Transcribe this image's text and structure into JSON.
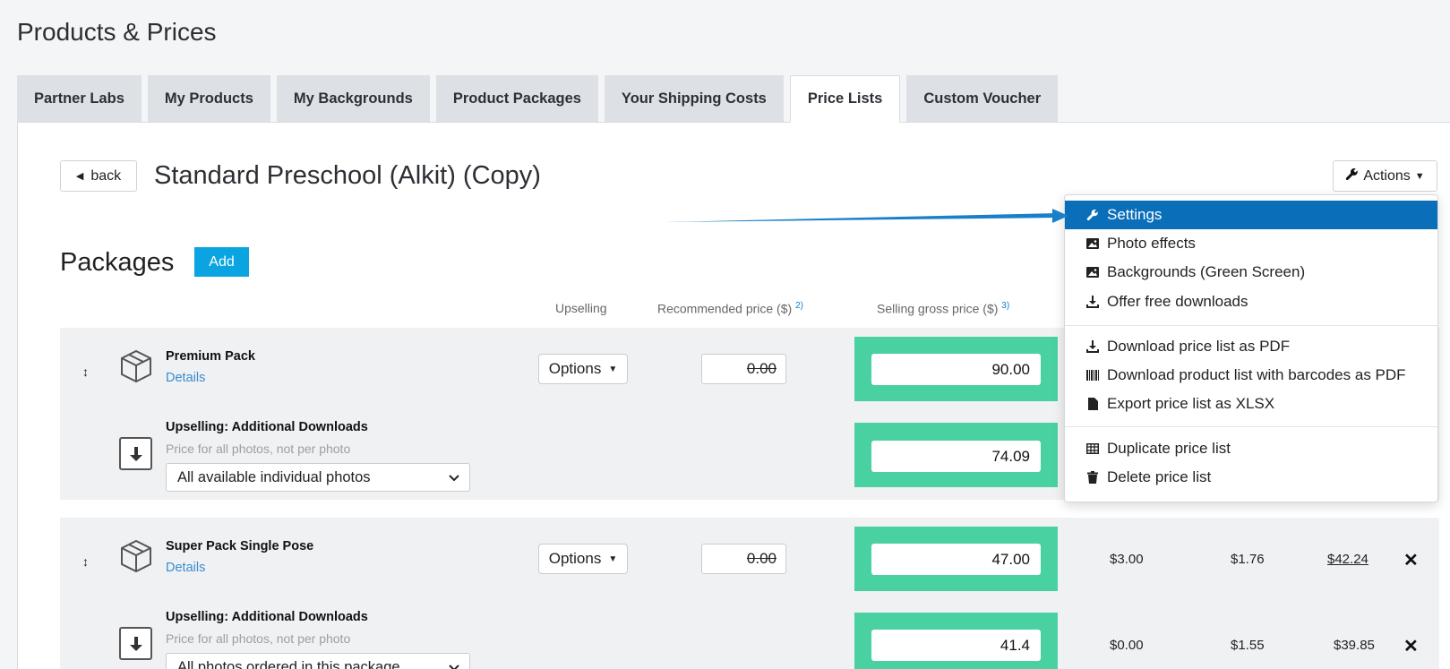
{
  "page": {
    "title": "Products & Prices"
  },
  "tabs": [
    {
      "label": "Partner Labs"
    },
    {
      "label": "My Products"
    },
    {
      "label": "My Backgrounds"
    },
    {
      "label": "Product Packages"
    },
    {
      "label": "Your Shipping Costs"
    },
    {
      "label": "Price Lists",
      "active": true
    },
    {
      "label": "Custom Voucher"
    }
  ],
  "header": {
    "back_label": "back",
    "list_title": "Standard Preschool (Alkit) (Copy)",
    "actions_label": "Actions"
  },
  "packages": {
    "title": "Packages",
    "add_label": "Add",
    "columns": {
      "upselling": "Upselling",
      "recommended": "Recommended price ($)",
      "recommended_note": "2)",
      "selling": "Selling gross price ($)",
      "selling_note": "3)"
    },
    "items": [
      {
        "name": "Premium Pack",
        "details_label": "Details",
        "options_label": "Options",
        "recommended_price": "0.00",
        "selling_price": "90.00",
        "upsell": {
          "title": "Upselling: Additional Downloads",
          "subtitle": "Price for all photos, not per photo",
          "select_value": "All available individual photos",
          "selling_price": "74.09"
        }
      },
      {
        "name": "Super Pack Single Pose",
        "details_label": "Details",
        "options_label": "Options",
        "recommended_price": "0.00",
        "selling_price": "47.00",
        "col_a": "$3.00",
        "col_b": "$1.76",
        "col_c": "$42.24",
        "upsell": {
          "title": "Upselling: Additional Downloads",
          "subtitle": "Price for all photos, not per photo",
          "select_value": "All photos ordered in this package",
          "selling_price": "41.4",
          "col_a": "$0.00",
          "col_b": "$1.55",
          "col_c": "$39.85"
        }
      }
    ]
  },
  "actions_menu": {
    "items": [
      {
        "label": "Settings",
        "icon": "wrench-icon",
        "active": true
      },
      {
        "label": "Photo effects",
        "icon": "image-icon"
      },
      {
        "label": "Backgrounds (Green Screen)",
        "icon": "image-icon"
      },
      {
        "label": "Offer free downloads",
        "icon": "download-icon"
      },
      {
        "label": "Download price list as PDF",
        "icon": "download-icon"
      },
      {
        "label": "Download product list with barcodes as PDF",
        "icon": "barcode-icon"
      },
      {
        "label": "Export price list as XLSX",
        "icon": "file-icon"
      },
      {
        "label": "Duplicate price list",
        "icon": "table-icon"
      },
      {
        "label": "Delete price list",
        "icon": "trash-icon"
      }
    ]
  },
  "colors": {
    "accent_blue": "#0aa5e0",
    "menu_active": "#0a6fb8",
    "price_highlight": "#49d1a1",
    "link": "#3a8dcf"
  }
}
